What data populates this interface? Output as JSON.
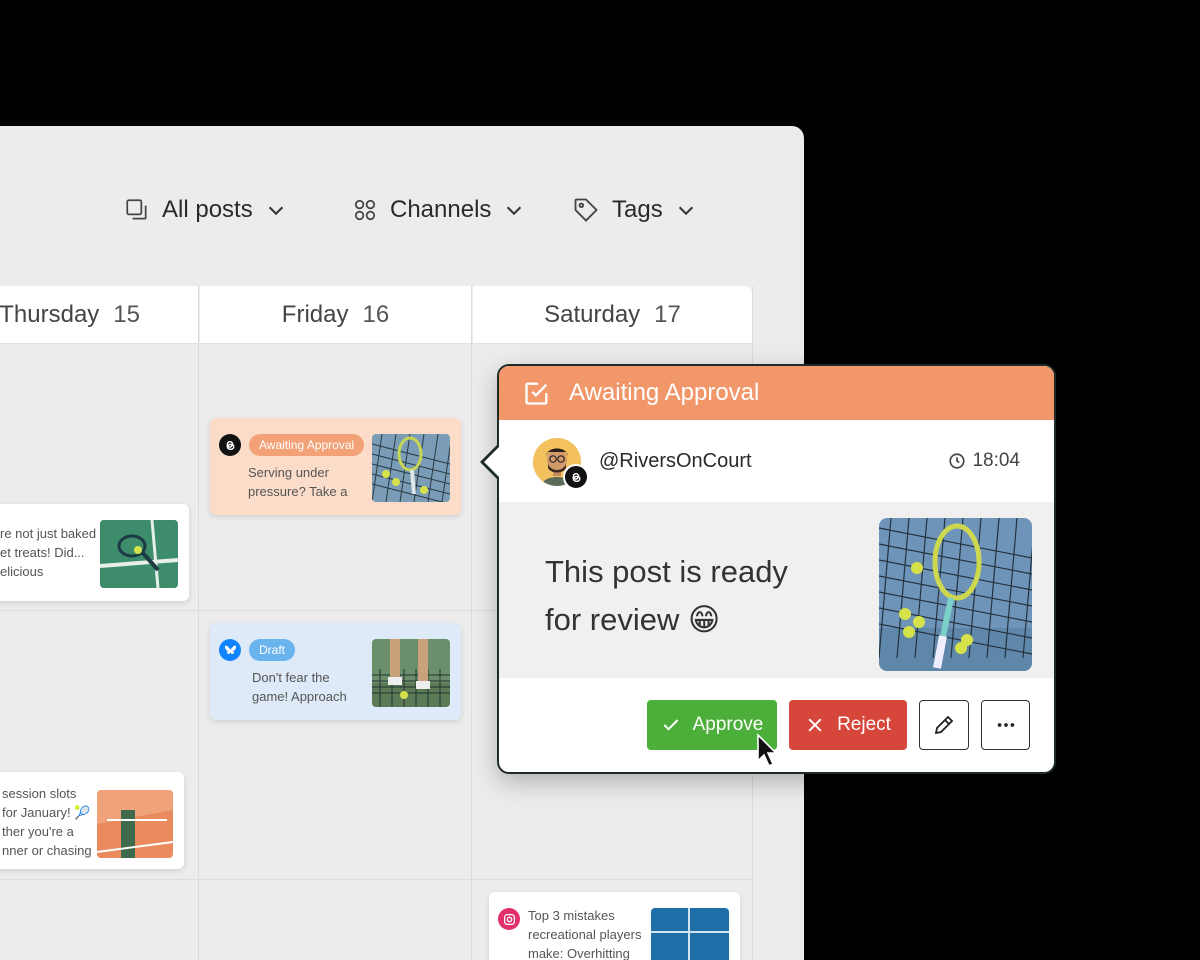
{
  "filters": {
    "all_posts": "All posts",
    "channels": "Channels",
    "tags": "Tags"
  },
  "calendar": {
    "days": [
      {
        "name": "Thursday",
        "num": "15"
      },
      {
        "name": "Friday",
        "num": "16"
      },
      {
        "name": "Saturday",
        "num": "17"
      }
    ]
  },
  "cards": {
    "thu_top": {
      "line1": "re not just baked",
      "line2": "et treats! Did...",
      "line3": "elicious"
    },
    "thu_bottom": {
      "line1": "session slots",
      "line2": "for January! 🎾",
      "line3": "ther you're a",
      "line4": "nner or chasing"
    },
    "fri_awaiting": {
      "badge": "Awaiting Approval",
      "line1": "Serving under",
      "line2": "pressure? Take a"
    },
    "fri_draft": {
      "badge": "Draft",
      "line1": "Don't fear the",
      "line2": "game! Approach"
    },
    "sat_bottom": {
      "line1": "Top 3 mistakes",
      "line2": "recreational players",
      "line3": "make: Overhitting"
    }
  },
  "popover": {
    "status": "Awaiting Approval",
    "handle": "@RiversOnCourt",
    "time": "18:04",
    "line1": "This post is ready",
    "line2": "for review 😁",
    "approve": "Approve",
    "reject": "Reject"
  },
  "colors": {
    "awaiting": "#f2976a",
    "draft": "#6ab4ee",
    "approve": "#4caf3a",
    "reject": "#d6463a",
    "instagram": "#e1306c",
    "bluesky": "#1185fe"
  },
  "icons": {
    "all_posts": "copy-icon",
    "channels": "grid-dots-icon",
    "tags": "tag-icon",
    "status": "checkbox-edit-icon",
    "time": "clock-icon",
    "edit": "pencil-icon",
    "more": "ellipsis-icon"
  }
}
